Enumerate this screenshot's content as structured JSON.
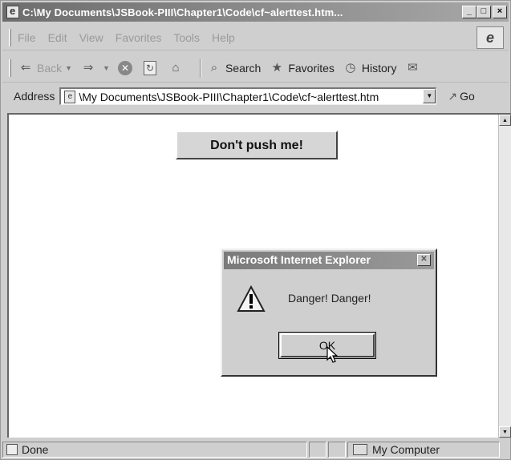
{
  "window": {
    "title": "C:\\My Documents\\JSBook-PIII\\Chapter1\\Code\\cf~alerttest.htm...",
    "caption_buttons": {
      "minimize": "_",
      "maximize": "□",
      "close": "×"
    }
  },
  "menu": {
    "items": [
      "File",
      "Edit",
      "View",
      "Favorites",
      "Tools",
      "Help"
    ]
  },
  "toolbar": {
    "back_label": "Back",
    "search_label": "Search",
    "favorites_label": "Favorites",
    "history_label": "History"
  },
  "address": {
    "label": "Address",
    "value": "\\My Documents\\JSBook-PIII\\Chapter1\\Code\\cf~alerttest.htm",
    "go_label": "Go"
  },
  "page": {
    "button_label": "Don't push me!"
  },
  "dialog": {
    "title": "Microsoft Internet Explorer",
    "message": "Danger! Danger!",
    "ok_label": "OK"
  },
  "status": {
    "text": "Done",
    "zone": "My Computer"
  }
}
